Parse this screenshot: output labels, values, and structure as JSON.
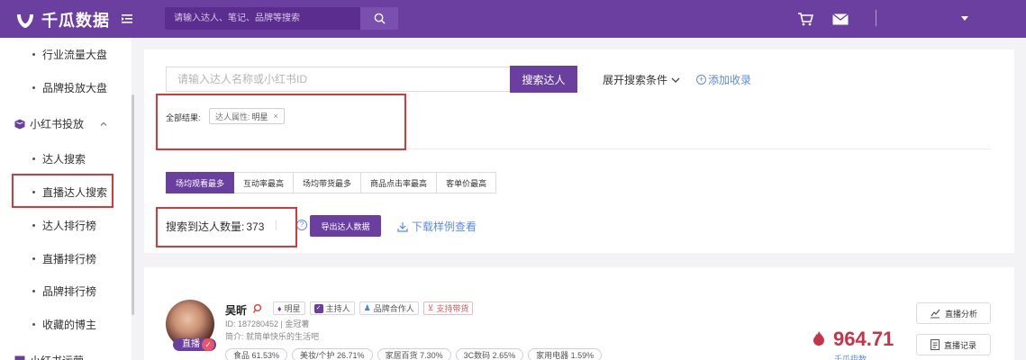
{
  "header": {
    "brand": "千瓜数据",
    "search_placeholder": "请输入达人、笔记、品牌等搜索"
  },
  "sidebar": {
    "items_top": [
      "行业流量大盘",
      "品牌投放大盘"
    ],
    "group": "小红书投放",
    "group_items": [
      "达人搜索",
      "直播达人搜索",
      "达人排行榜",
      "直播排行榜",
      "品牌排行榜",
      "收藏的博主"
    ],
    "next_group": "小红书运营"
  },
  "search": {
    "placeholder": "请输入达人名称或小红书ID",
    "button": "搜索达人",
    "expand": "展开搜索条件",
    "add_fav": "添加收录"
  },
  "filters": {
    "all_label": "全部结果:",
    "tag_key": "达人属性:",
    "tag_value": "明星",
    "tag_close": "×"
  },
  "sort_tabs": [
    "场均观看最多",
    "互动率最高",
    "场均带货最多",
    "商品点击率最高",
    "客单价最高"
  ],
  "results": {
    "count_label": "搜索到达人数量:",
    "count": "373",
    "export": "导出达人数据",
    "download": "下载样例查看",
    "help": "?"
  },
  "influencer": {
    "name": "吴昕",
    "live_badge": "直播",
    "badges": [
      "明星",
      "主持人",
      "品牌合作人",
      "支持带货"
    ],
    "id_line": "ID: 187280452 | 金冠薯",
    "intro": "简介: 就简单快乐的生活吧",
    "categories": [
      "食品 61.53%",
      "美妆/个护 26.71%",
      "家居百货 7.30%",
      "3C数码 2.65%",
      "家用电器 1.59%"
    ],
    "score": "964.71",
    "score_label": "千瓜指数",
    "actions": [
      "直播分析",
      "直播记录"
    ]
  },
  "colors": {
    "brand": "#6b3fa0",
    "highlight": "#d33a3a",
    "link": "#5b8de0",
    "score": "#c7344a"
  }
}
